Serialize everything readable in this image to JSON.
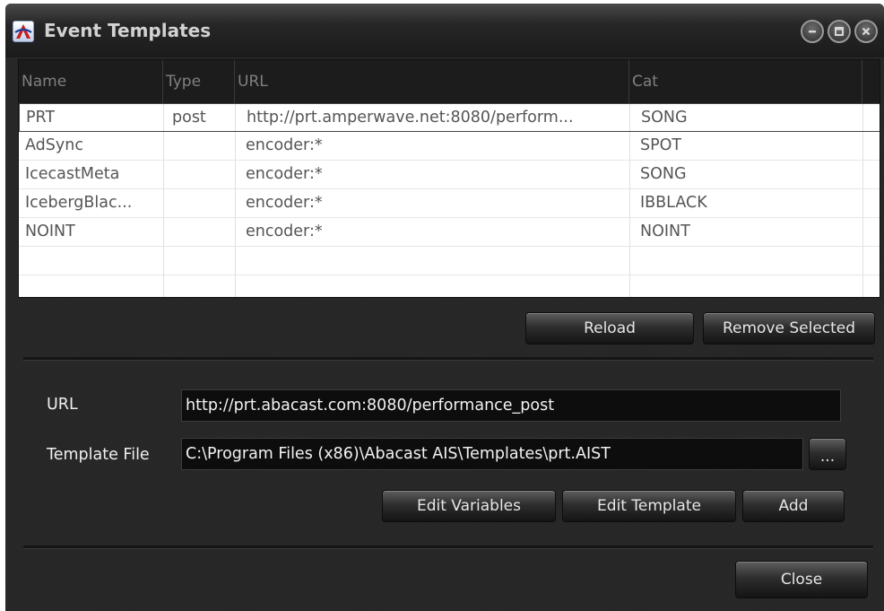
{
  "window": {
    "title": "Event Templates",
    "icon": "abacast-logo-icon",
    "controls": [
      "minimize-icon",
      "maximize-icon",
      "close-icon"
    ]
  },
  "grid": {
    "columns": [
      "Name",
      "Type",
      "URL",
      "Cat"
    ],
    "rows": [
      {
        "name": "PRT",
        "type": "post",
        "url": "http://prt.amperwave.net:8080/perform...",
        "cat": "SONG"
      },
      {
        "name": "AdSync",
        "type": "",
        "url": "encoder:*",
        "cat": "SPOT"
      },
      {
        "name": "IcecastMeta",
        "type": "",
        "url": "encoder:*",
        "cat": "SONG"
      },
      {
        "name": "IcebergBlac...",
        "type": "",
        "url": "encoder:*",
        "cat": "IBBLACK"
      },
      {
        "name": "NOINT",
        "type": "",
        "url": "encoder:*",
        "cat": "NOINT"
      }
    ]
  },
  "actions": {
    "reload": "Reload",
    "remove_selected": "Remove Selected"
  },
  "form": {
    "url_label": "URL",
    "url_value": "http://prt.abacast.com:8080/performance_post",
    "template_label": "Template File",
    "template_value": "C:\\Program Files (x86)\\Abacast AIS\\Templates\\prt.AIST",
    "browse_label": "...",
    "edit_variables": "Edit Variables",
    "edit_template": "Edit Template",
    "add": "Add"
  },
  "footer": {
    "close": "Close"
  }
}
